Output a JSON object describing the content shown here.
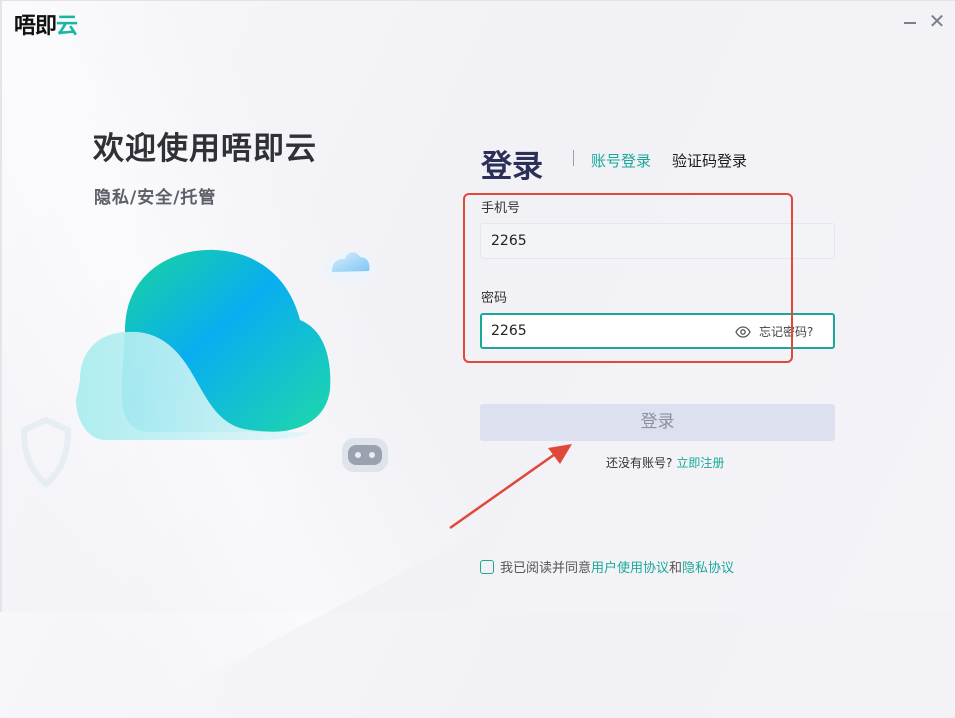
{
  "app": {
    "logo_main": "唔即",
    "logo_accent": "云"
  },
  "window": {
    "minimize_glyph": "–",
    "close_glyph": "✕"
  },
  "hero": {
    "welcome": "欢迎使用唔即云",
    "tagline": "隐私/安全/托管"
  },
  "login": {
    "title": "登录",
    "tabs": [
      {
        "label": "账号登录",
        "active": true
      },
      {
        "label": "验证码登录",
        "active": false
      }
    ],
    "phone": {
      "label": "手机号",
      "value": "2265"
    },
    "password": {
      "label": "密码",
      "value": "2265",
      "forgot": "忘记密码?"
    },
    "submit": "登录",
    "no_account": "还没有账号?",
    "register": "立即注册"
  },
  "agreement": {
    "prefix": "我已阅读并同意",
    "terms": "用户使用协议",
    "and": "和",
    "privacy": "隐私协议"
  },
  "colors": {
    "accent": "#1aa999",
    "highlight": "#e0483a",
    "button_bg": "#dde0ef"
  }
}
